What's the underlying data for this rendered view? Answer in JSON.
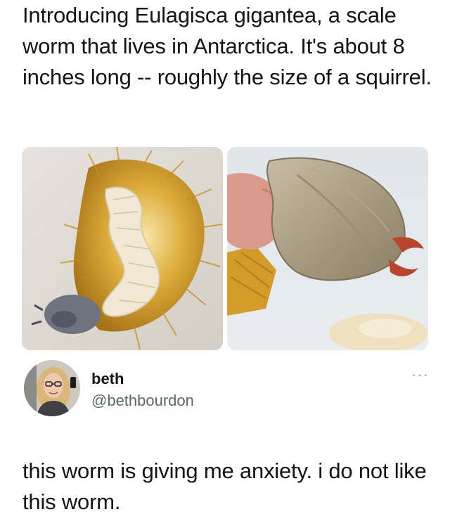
{
  "meme": {
    "caption": "Introducing Eulagisca gigantea, a scale worm that lives in Antarctica. It's about 8 inches long -- roughly the size of a squirrel."
  },
  "photos": [
    {
      "icon": "worm-photo-golden-bristles"
    },
    {
      "icon": "worm-photo-head-jaws"
    }
  ],
  "tweet": {
    "author_name": "beth",
    "author_handle": "@bethbourdon",
    "more_icon": "···",
    "text": "this worm is giving me anxiety. i do not like this worm."
  },
  "colors": {
    "text": "#141414",
    "handle": "#5c6870",
    "gold": "#d9a732"
  }
}
